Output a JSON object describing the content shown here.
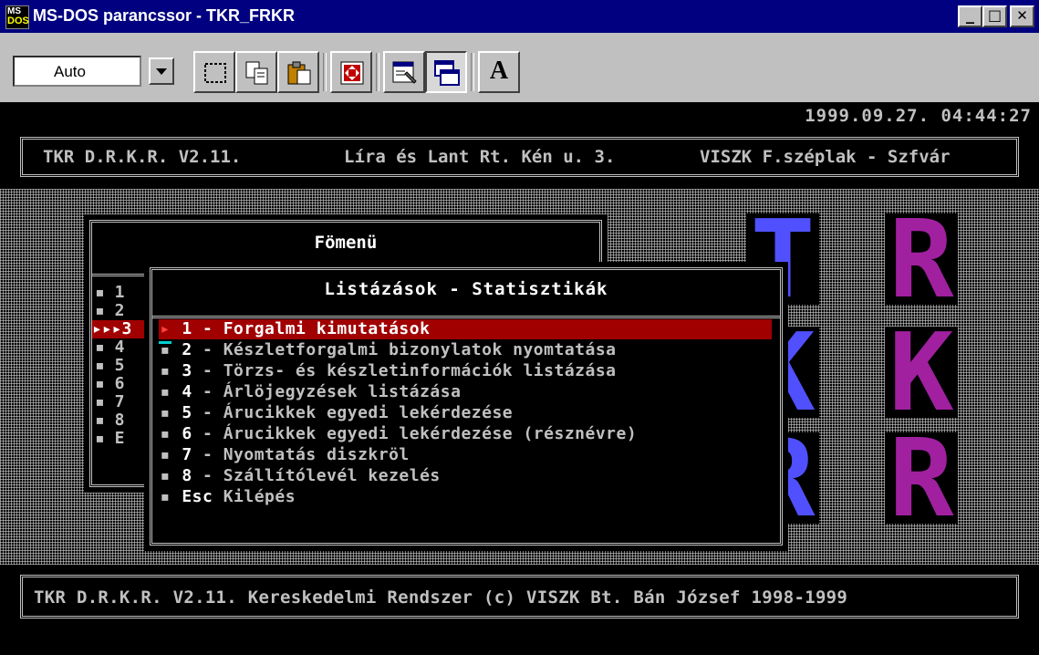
{
  "window": {
    "title": "MS-DOS parancssor - TKR_FRKR",
    "icon_top": "MS",
    "icon_bottom": "DOS",
    "minimize": "_",
    "maximize": "□",
    "close": "✕"
  },
  "toolbar": {
    "font_size_value": "Auto",
    "font_button_label": "A"
  },
  "console": {
    "datetime": "1999.09.27. 04:44:27",
    "header": {
      "version": "TKR D.R.K.R. V2.11.",
      "company": "Líra és Lant Rt. Kén u. 3.",
      "branch": "VISZK F.széplak - Szfvár"
    },
    "logo_letters": [
      "T",
      "R",
      "K",
      "K",
      "R",
      "R"
    ],
    "main_menu": {
      "title": "Fömenü",
      "items": [
        "▪ 1",
        "▪ 2",
        "▸▸▸3",
        "▪ 4",
        "▪ 5",
        "▪ 6",
        "▪ 7",
        "▪ 8",
        "▪ E"
      ]
    },
    "submenu": {
      "title": "Listázások - Statisztikák",
      "items": [
        {
          "bullet": "▸",
          "key": "1",
          "label": " - Forgalmi kimutatások"
        },
        {
          "bullet": "▪",
          "key": "2",
          "label": " - Készletforgalmi bizonylatok nyomtatása"
        },
        {
          "bullet": "▪",
          "key": "3",
          "label": " - Törzs- és készletinformációk listázása"
        },
        {
          "bullet": "▪",
          "key": "4",
          "label": " - Árlöjegyzések listázása"
        },
        {
          "bullet": "▪",
          "key": "5",
          "label": " - Árucikkek egyedi lekérdezése"
        },
        {
          "bullet": "▪",
          "key": "6",
          "label": " - Árucikkek egyedi lekérdezése (résznévre)"
        },
        {
          "bullet": "▪",
          "key": "7",
          "label": " - Nyomtatás diszkröl"
        },
        {
          "bullet": "▪",
          "key": "8",
          "label": " - Szállítólevél kezelés"
        },
        {
          "bullet": "▪",
          "key": "Esc",
          "label": " Kilépés"
        }
      ]
    },
    "footer": "TKR D.R.K.R. V2.11. Kereskedelmi Rendszer (c) VISZK Bt. Bán József 1998-1999"
  },
  "colors": {
    "title_bar": "#000080",
    "selection": "#a00000",
    "logo_blue": "#5050ff",
    "logo_purple": "#a020a0"
  }
}
